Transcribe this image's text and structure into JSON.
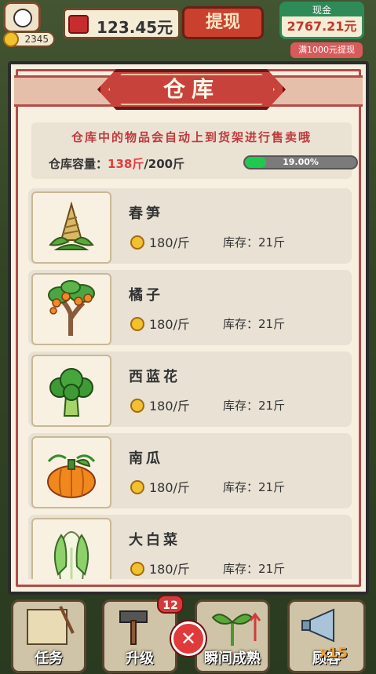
{
  "topbar": {
    "coins": "2345",
    "cash_amount": "123.45元",
    "withdraw_label": "提现",
    "cash_panel_header": "现金",
    "cash_panel_value": "2767.21元",
    "limit_badge": "满1000元提现"
  },
  "warehouse": {
    "title": "仓库",
    "tip": "仓库中的物品会自动上到货架进行售卖哦",
    "capacity_label": "仓库容量：",
    "capacity_used": "138斤",
    "capacity_total": "/200斤",
    "capacity_percent_text": "19.00%",
    "capacity_fill": 0.19,
    "items": [
      {
        "name": "春笋",
        "price": "180/斤",
        "stock": "库存：21斤",
        "icon": "bamboo-shoot-icon"
      },
      {
        "name": "橘子",
        "price": "180/斤",
        "stock": "库存：21斤",
        "icon": "orange-tree-icon"
      },
      {
        "name": "西蓝花",
        "price": "180/斤",
        "stock": "库存：21斤",
        "icon": "broccoli-icon"
      },
      {
        "name": "南瓜",
        "price": "180/斤",
        "stock": "库存：21斤",
        "icon": "pumpkin-icon"
      },
      {
        "name": "大白菜",
        "price": "180/斤",
        "stock": "库存：21斤",
        "icon": "cabbage-icon"
      }
    ]
  },
  "bottombar": {
    "task_label": "任务",
    "upgrade_label": "升级",
    "upgrade_badge": "12",
    "ripen_label": "瞬间成熟",
    "customer_label": "顾客",
    "customer_count": "x15"
  },
  "colors": {
    "accent_red": "#c8423c",
    "progress_green": "#21c74f",
    "capacity_red": "#e23b3b"
  }
}
